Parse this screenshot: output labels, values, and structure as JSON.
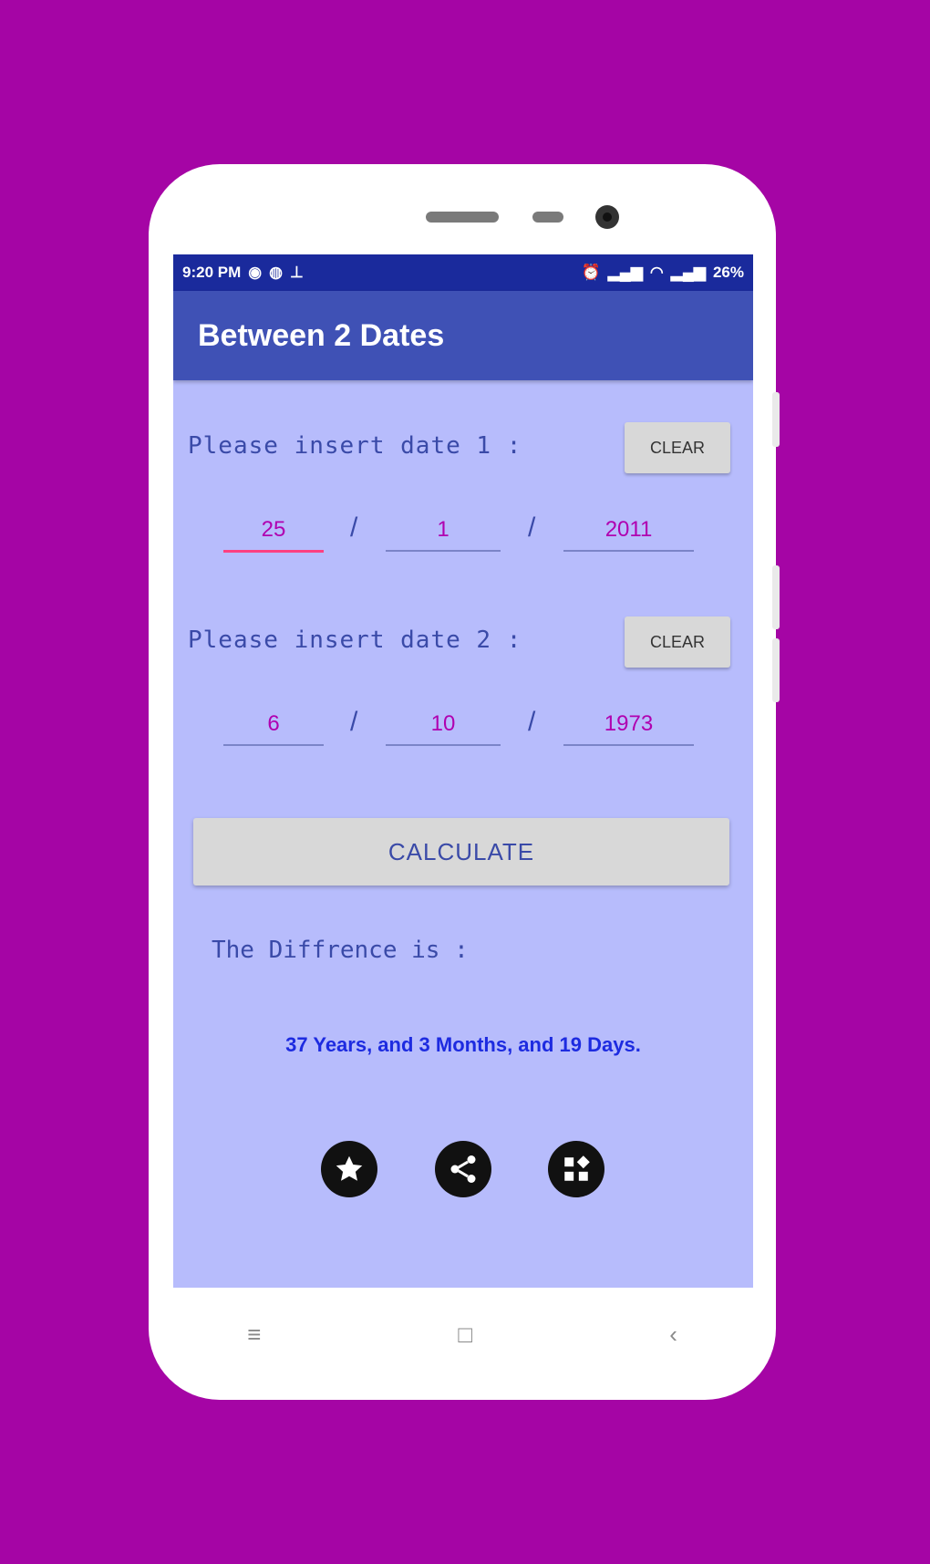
{
  "status_bar": {
    "time": "9:20 PM",
    "right_text": "26%"
  },
  "app": {
    "title": "Between 2 Dates"
  },
  "date1": {
    "label": "Please insert date 1 :",
    "clear_label": "CLEAR",
    "day": "25",
    "month": "1",
    "year": "2011"
  },
  "date2": {
    "label": "Please insert date 2 :",
    "clear_label": "CLEAR",
    "day": "6",
    "month": "10",
    "year": "1973"
  },
  "separator": "/",
  "calculate_label": "CALCULATE",
  "difference_label": "The Diffrence is :",
  "result_text": "37 Years, and 3 Months, and 19 Days.",
  "icons": [
    "star-icon",
    "share-icon",
    "apps-icon"
  ],
  "nav": {
    "recent": "≡",
    "home": "□",
    "back": "‹"
  },
  "colors": {
    "background": "#a505a5",
    "app_bar": "#3f51b5",
    "status_bar": "#1a2a9c",
    "screen": "#b7bcfc",
    "input_text": "#b000b0",
    "result_text": "#1d2be0",
    "accent": "#ff4081"
  }
}
